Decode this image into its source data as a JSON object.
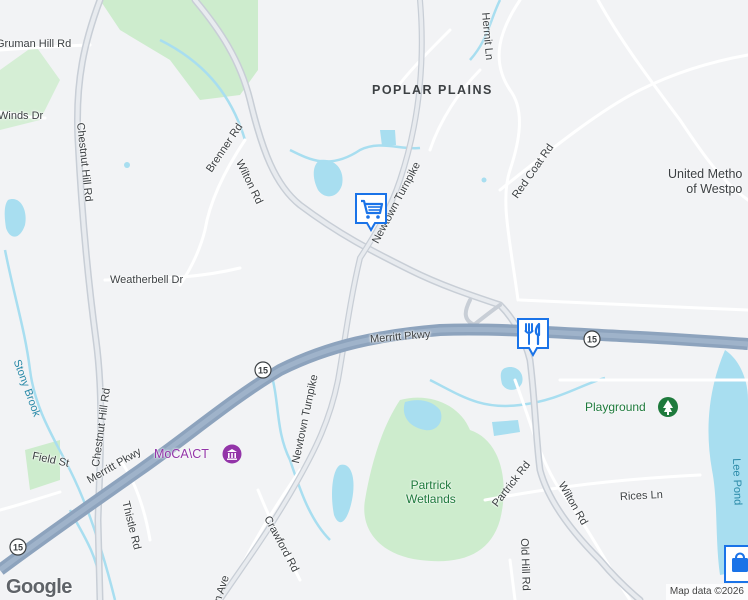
{
  "map": {
    "neighborhood": "POPLAR PLAINS",
    "roads": {
      "merritt_pkwy_east": "Merritt Pkwy",
      "merritt_pkwy_west": "Merritt Pkwy",
      "wilton_rd_north": "Wilton Rd",
      "wilton_rd_south": "Wilton Rd",
      "newtown_tpk_south": "Newtown Turnpike",
      "newtown_tpk_north": "Newtown Turnpike",
      "chestnut_hill_north": "Chestnut Hill Rd",
      "chestnut_hill_south": "Chestnut Hill Rd",
      "brenner_rd": "Brenner Rd",
      "weatherbell_dr": "Weatherbell Dr",
      "gruman_hill_rd": "Gruman Hill Rd",
      "winds_dr": "Winds Dr",
      "hermit_ln": "Hermit Ln",
      "red_coat_rd": "Red Coat Rd",
      "partrick_rd": "Partrick Rd",
      "rices_ln": "Rices Ln",
      "old_hill_rd": "Old Hill Rd",
      "crawford_rd": "Crawford Rd",
      "thistle_rd": "Thistle Rd",
      "field_st": "Field St",
      "ave_partial": "n Ave"
    },
    "shields": {
      "route_number": "15"
    },
    "parks": {
      "wetlands": "Partrick\nWetlands",
      "playground": "Playground"
    },
    "places": {
      "museum": "MoCA\\CT",
      "church_line1": "United Metho",
      "church_line2": "of Westpo"
    },
    "water": {
      "brook": "Stony Brook",
      "pond": "Lee Pond"
    },
    "icons": {
      "shopping": "shopping-cart-icon",
      "restaurant": "fork-knife-icon",
      "shopping_bag": "shopping-bag-icon",
      "museum": "museum-icon",
      "park": "tree-icon"
    },
    "colors": {
      "background": "#f2f3f5",
      "park": "#cdeccd",
      "water": "#a8def0",
      "highway": "#8da3bd",
      "road": "#ffffff",
      "marker": "#1a73e8",
      "poi_purple": "#9334a8",
      "park_text": "#1e7a3c"
    }
  },
  "branding": {
    "logo": "Google",
    "attribution": "Map data ©2026"
  }
}
